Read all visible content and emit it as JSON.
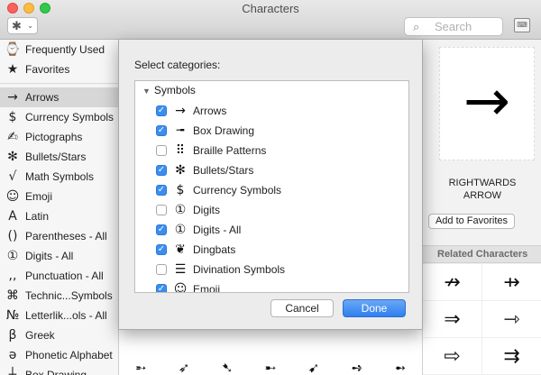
{
  "window": {
    "title": "Characters"
  },
  "toolbar": {
    "gear_glyph": "✱",
    "chevron": "⌄",
    "search_placeholder": "Search",
    "search_glyph": "⌕",
    "keyboard_glyph": "⌨"
  },
  "sidebar": {
    "top_items": [
      {
        "icon": "⌚",
        "label": "Frequently Used"
      },
      {
        "icon": "★",
        "label": "Favorites"
      }
    ],
    "items": [
      {
        "icon": "→",
        "label": "Arrows"
      },
      {
        "icon": "$",
        "label": "Currency Symbols"
      },
      {
        "icon": "✍",
        "label": "Pictographs"
      },
      {
        "icon": "✻",
        "label": "Bullets/Stars"
      },
      {
        "icon": "√",
        "label": "Math Symbols"
      },
      {
        "icon": "☺",
        "label": "Emoji"
      },
      {
        "icon": "A",
        "label": "Latin"
      },
      {
        "icon": "()",
        "label": "Parentheses - All"
      },
      {
        "icon": "①",
        "label": "Digits - All"
      },
      {
        "icon": ",,",
        "label": "Punctuation - All"
      },
      {
        "icon": "⌘",
        "label": "Technic...Symbols"
      },
      {
        "icon": "№",
        "label": "Letterlik...ols - All"
      },
      {
        "icon": "β",
        "label": "Greek"
      },
      {
        "icon": "ə",
        "label": "Phonetic Alphabet"
      },
      {
        "icon": "┼",
        "label": "Box Drawing"
      }
    ]
  },
  "detail": {
    "preview_glyph": "→",
    "char_name": "RIGHTWARDS ARROW",
    "add_favorites": "Add to Favorites",
    "related_header": "Related Characters",
    "related": [
      "↛",
      "⇸",
      "⇒",
      "⇾",
      "⇨",
      "⇉"
    ]
  },
  "background_glyphs": [
    "➵",
    "➶",
    "➷",
    "➸",
    "➹",
    "➺",
    "➻"
  ],
  "sheet": {
    "prompt": "Select categories:",
    "group_label": "Symbols",
    "group_triangle": "▼",
    "check_glyph": "✓",
    "rows": [
      {
        "glyph": "→",
        "label": "Arrows",
        "checked": true
      },
      {
        "glyph": "╼",
        "label": "Box Drawing",
        "checked": true
      },
      {
        "glyph": "⠿",
        "label": "Braille Patterns",
        "checked": false
      },
      {
        "glyph": "✻",
        "label": "Bullets/Stars",
        "checked": true
      },
      {
        "glyph": "$",
        "label": "Currency Symbols",
        "checked": true
      },
      {
        "glyph": "①",
        "label": "Digits",
        "checked": false
      },
      {
        "glyph": "①",
        "label": "Digits - All",
        "checked": true
      },
      {
        "glyph": "❦",
        "label": "Dingbats",
        "checked": true
      },
      {
        "glyph": "☰",
        "label": "Divination Symbols",
        "checked": false
      },
      {
        "glyph": "☺",
        "label": "Emoji",
        "checked": true
      }
    ],
    "cancel_label": "Cancel",
    "done_label": "Done"
  }
}
